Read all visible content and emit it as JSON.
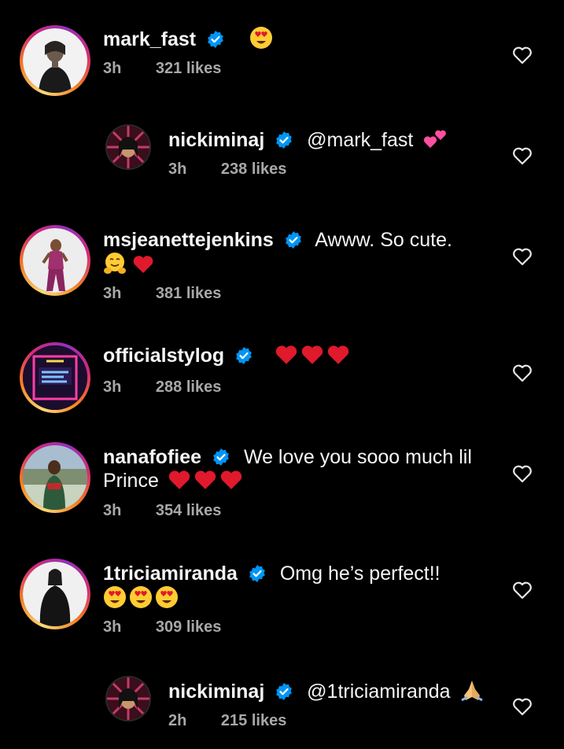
{
  "colors": {
    "background": "#000000",
    "text": "#f5f5f5",
    "meta": "#a8a8a8",
    "verified": "#0095f6",
    "heart_emoji": "#e0192d"
  },
  "comments": [
    {
      "username": "mark_fast",
      "text": "",
      "emojis": [
        "heart-eyes-emoji"
      ],
      "time": "3h",
      "likes": "321 likes",
      "reply": false
    },
    {
      "username": "nickiminaj",
      "text": "@mark_fast",
      "emojis": [
        "two-hearts-emoji"
      ],
      "time": "3h",
      "likes": "238 likes",
      "reply": true
    },
    {
      "username": "msjeanettejenkins",
      "text": "Awww. So cute.",
      "emojis": [
        "hugging-face-emoji",
        "red-heart-emoji"
      ],
      "time": "3h",
      "likes": "381 likes",
      "reply": false
    },
    {
      "username": "officialstylog",
      "text": "",
      "emojis": [
        "red-heart-emoji",
        "red-heart-emoji",
        "red-heart-emoji"
      ],
      "time": "3h",
      "likes": "288 likes",
      "reply": false
    },
    {
      "username": "nanafofiee",
      "text": "We love you sooo much lil Prince",
      "emojis": [
        "red-heart-emoji",
        "red-heart-emoji",
        "red-heart-emoji"
      ],
      "time": "3h",
      "likes": "354 likes",
      "reply": false
    },
    {
      "username": "1triciamiranda",
      "text": "Omg he’s perfect!!",
      "emojis": [
        "heart-eyes-emoji",
        "heart-eyes-emoji",
        "heart-eyes-emoji"
      ],
      "time": "3h",
      "likes": "309 likes",
      "reply": false
    },
    {
      "username": "nickiminaj",
      "text": "@1triciamiranda",
      "emojis": [
        "folded-hands-emoji"
      ],
      "time": "2h",
      "likes": "215 likes",
      "reply": true
    }
  ]
}
